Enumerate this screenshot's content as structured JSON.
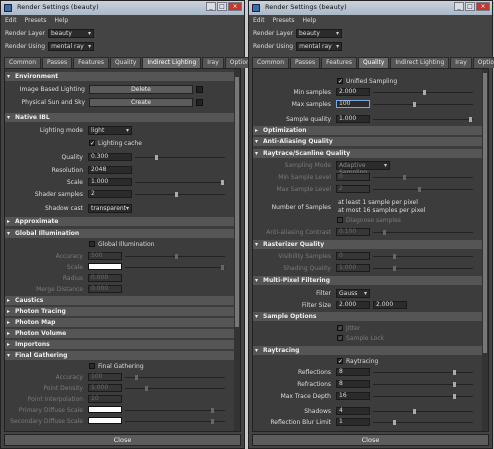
{
  "window_title": "Render Settings (beauty)",
  "menu": [
    "Edit",
    "Presets",
    "Help"
  ],
  "render_layer_label": "Render Layer",
  "render_layer_value": "beauty",
  "render_using_label": "Render Using",
  "render_using_value": "mental ray",
  "tabs": [
    "Common",
    "Passes",
    "Features",
    "Quality",
    "Indirect Lighting",
    "Iray",
    "Options"
  ],
  "close_label": "Close",
  "left": {
    "environment": {
      "title": "Environment",
      "ibl_label": "Image Based Lighting",
      "ibl_btn": "Delete",
      "sun_label": "Physical Sun and Sky",
      "sun_btn": "Create"
    },
    "native_ibl": {
      "title": "Native IBL",
      "mode_label": "Lighting mode",
      "mode_value": "light",
      "cache_label": "Lighting cache",
      "quality_label": "Quality",
      "quality_value": "0.300",
      "resolution_label": "Resolution",
      "resolution_value": "2048",
      "scale_label": "Scale",
      "scale_value": "1.000",
      "shader_samples_label": "Shader samples",
      "shader_samples_value": "2",
      "shadow_cast_label": "Shadow cast",
      "shadow_cast_value": "transparent"
    },
    "approximate": "Approximate",
    "global_illumination": {
      "title": "Global Illumination",
      "gi_check": "Global Illumination",
      "accuracy_label": "Accuracy",
      "accuracy_value": "500",
      "scale_label": "Scale",
      "radius_label": "Radius",
      "radius_value": "0.000",
      "merge_label": "Merge Distance",
      "merge_value": "0.000"
    },
    "collapsed": [
      "Caustics",
      "Photon Tracing",
      "Photon Map",
      "Photon Volume",
      "Importons"
    ],
    "final_gathering": {
      "title": "Final Gathering",
      "fg_check": "Final Gathering",
      "accuracy_label": "Accuracy",
      "accuracy_value": "100",
      "point_density_label": "Point Density",
      "point_density_value": "1.000",
      "point_interp_label": "Point Interpolation",
      "point_interp_value": "10",
      "primary_label": "Primary Diffuse Scale",
      "secondary_label": "Secondary Diffuse Scale"
    }
  },
  "right": {
    "top": {
      "unified_check": "Unified Sampling",
      "min_label": "Min samples",
      "min_value": "2.000",
      "max_label": "Max samples",
      "max_value": "100",
      "quality_label": "Sample quality",
      "quality_value": "1.000"
    },
    "optimization": "Optimization",
    "anti_aliasing": "Anti-Aliasing Quality",
    "raytrace_scanline": {
      "title": "Raytrace/Scanline Quality",
      "sampling_mode_label": "Sampling Mode",
      "sampling_mode_value": "Adaptive Sampling",
      "min_level_label": "Min Sample Level",
      "min_level_value": "0",
      "max_level_label": "Max Sample Level",
      "max_level_value": "2",
      "num_samples_label": "Number of Samples",
      "num_samples_line1": "at least 1 sample per pixel",
      "num_samples_line2": "at most 16 samples per pixel",
      "diagnose_check": "Diagnose samples",
      "contrast_label": "Anti-aliasing Contrast",
      "contrast_value": "0.100"
    },
    "rasterizer": {
      "title": "Rasterizer Quality",
      "visibility_label": "Visibility Samples",
      "visibility_value": "0",
      "shading_label": "Shading Quality",
      "shading_value": "1.000"
    },
    "multipixel": {
      "title": "Multi-Pixel Filtering",
      "filter_label": "Filter",
      "filter_value": "Gauss",
      "filter_size_label": "Filter Size",
      "filter_size_x": "2.000",
      "filter_size_y": "2.000"
    },
    "sample_options": {
      "title": "Sample Options",
      "jitter_check": "Jitter",
      "sample_lock_check": "Sample Lock"
    },
    "raytracing": {
      "title": "Raytracing",
      "raytracing_check": "Raytracing",
      "reflections_label": "Reflections",
      "reflections_value": "8",
      "refractions_label": "Refractions",
      "refractions_value": "8",
      "max_depth_label": "Max Trace Depth",
      "max_depth_value": "16",
      "shadows_label": "Shadows",
      "shadows_value": "4",
      "blur_label": "Reflection Blur Limit",
      "blur_value": "1"
    }
  }
}
